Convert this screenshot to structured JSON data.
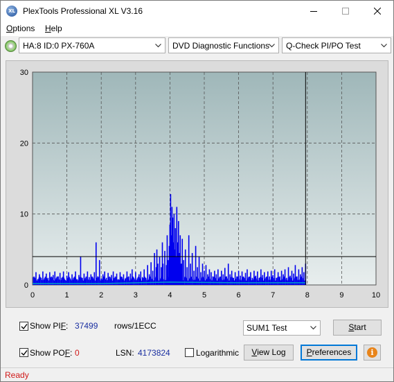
{
  "window": {
    "title": "PlexTools Professional XL V3.16",
    "icon_label": "XL"
  },
  "menu": [
    {
      "label": "Options",
      "accel": "O",
      "rest": "ptions"
    },
    {
      "label": "Help",
      "accel": "H",
      "rest": "elp"
    }
  ],
  "toolbar": {
    "drive": "HA:8 ID:0  PX-760A",
    "function": "DVD Diagnostic Functions",
    "test": "Q-Check PI/PO Test"
  },
  "chart_data": {
    "type": "bar",
    "x_ticks": [
      "0",
      "1",
      "2",
      "3",
      "4",
      "5",
      "6",
      "7",
      "8",
      "9",
      "10"
    ],
    "y_ticks": [
      "0",
      "10",
      "20",
      "30"
    ],
    "xlim": [
      0,
      10
    ],
    "ylim": [
      0,
      30
    ],
    "grid": true,
    "threshold_line": 4,
    "data_end_x": 7.95,
    "series": [
      {
        "color": "#0000ee",
        "kind": "PIF-spikes",
        "points": [
          [
            0.05,
            1
          ],
          [
            0.1,
            1.8
          ],
          [
            0.15,
            0.8
          ],
          [
            0.2,
            1.5
          ],
          [
            0.25,
            1
          ],
          [
            0.3,
            1.9
          ],
          [
            0.35,
            0.7
          ],
          [
            0.4,
            1.6
          ],
          [
            0.45,
            1
          ],
          [
            0.5,
            1.8
          ],
          [
            0.55,
            0.9
          ],
          [
            0.6,
            1.4
          ],
          [
            0.65,
            1.9
          ],
          [
            0.7,
            0.8
          ],
          [
            0.75,
            1.2
          ],
          [
            0.8,
            1.7
          ],
          [
            0.85,
            1
          ],
          [
            0.9,
            1.9
          ],
          [
            0.95,
            0.7
          ],
          [
            1.0,
            1.3
          ],
          [
            1.05,
            1.8
          ],
          [
            1.1,
            0.9
          ],
          [
            1.15,
            1.5
          ],
          [
            1.2,
            1
          ],
          [
            1.25,
            1.9
          ],
          [
            1.3,
            0.8
          ],
          [
            1.35,
            1.4
          ],
          [
            1.4,
            4
          ],
          [
            1.45,
            1
          ],
          [
            1.5,
            1.6
          ],
          [
            1.55,
            0.8
          ],
          [
            1.6,
            1.9
          ],
          [
            1.65,
            1.1
          ],
          [
            1.7,
            1.5
          ],
          [
            1.75,
            0.9
          ],
          [
            1.8,
            1.8
          ],
          [
            1.85,
            6
          ],
          [
            1.9,
            1.2
          ],
          [
            1.95,
            3.5
          ],
          [
            2.0,
            0.9
          ],
          [
            2.05,
            1.5
          ],
          [
            2.1,
            1.9
          ],
          [
            2.15,
            1
          ],
          [
            2.2,
            1.7
          ],
          [
            2.25,
            0.8
          ],
          [
            2.3,
            1.4
          ],
          [
            2.35,
            1.9
          ],
          [
            2.4,
            1
          ],
          [
            2.45,
            1.6
          ],
          [
            2.5,
            0.8
          ],
          [
            2.55,
            1.8
          ],
          [
            2.6,
            1.1
          ],
          [
            2.65,
            1.5
          ],
          [
            2.7,
            0.9
          ],
          [
            2.75,
            1.9
          ],
          [
            2.8,
            1.2
          ],
          [
            2.85,
            1.6
          ],
          [
            2.9,
            2.2
          ],
          [
            2.95,
            1
          ],
          [
            3.0,
            1.8
          ],
          [
            3.05,
            0.9
          ],
          [
            3.1,
            1.5
          ],
          [
            3.15,
            1.9
          ],
          [
            3.2,
            1.1
          ],
          [
            3.25,
            2.2
          ],
          [
            3.3,
            1
          ],
          [
            3.35,
            2.8
          ],
          [
            3.4,
            1.5
          ],
          [
            3.45,
            3.2
          ],
          [
            3.5,
            2
          ],
          [
            3.55,
            4.5
          ],
          [
            3.6,
            2.5
          ],
          [
            3.62,
            5
          ],
          [
            3.65,
            3
          ],
          [
            3.7,
            4
          ],
          [
            3.75,
            2.5
          ],
          [
            3.78,
            6
          ],
          [
            3.8,
            3
          ],
          [
            3.85,
            4.8
          ],
          [
            3.9,
            2.8
          ],
          [
            3.92,
            7
          ],
          [
            3.95,
            3.5
          ],
          [
            3.98,
            5.5
          ],
          [
            4.0,
            8.5
          ],
          [
            4.02,
            12.8
          ],
          [
            4.04,
            7
          ],
          [
            4.06,
            11
          ],
          [
            4.08,
            9.5
          ],
          [
            4.1,
            6
          ],
          [
            4.12,
            10
          ],
          [
            4.14,
            5
          ],
          [
            4.16,
            8
          ],
          [
            4.18,
            4
          ],
          [
            4.2,
            11
          ],
          [
            4.22,
            6
          ],
          [
            4.25,
            9
          ],
          [
            4.28,
            4.5
          ],
          [
            4.3,
            7
          ],
          [
            4.33,
            3
          ],
          [
            4.36,
            6.5
          ],
          [
            4.4,
            3.5
          ],
          [
            4.45,
            5
          ],
          [
            4.5,
            2.5
          ],
          [
            4.55,
            7
          ],
          [
            4.6,
            3
          ],
          [
            4.65,
            4.5
          ],
          [
            4.7,
            2
          ],
          [
            4.75,
            5.5
          ],
          [
            4.8,
            2.5
          ],
          [
            4.85,
            4
          ],
          [
            4.9,
            1.8
          ],
          [
            4.95,
            3
          ],
          [
            5.0,
            2
          ],
          [
            5.05,
            2.8
          ],
          [
            5.1,
            1.5
          ],
          [
            5.15,
            2.2
          ],
          [
            5.2,
            1.8
          ],
          [
            5.25,
            1.2
          ],
          [
            5.3,
            2
          ],
          [
            5.35,
            1.5
          ],
          [
            5.4,
            2.2
          ],
          [
            5.45,
            1
          ],
          [
            5.5,
            2
          ],
          [
            5.55,
            1.5
          ],
          [
            5.6,
            2.4
          ],
          [
            5.65,
            1.2
          ],
          [
            5.7,
            3
          ],
          [
            5.75,
            1.5
          ],
          [
            5.8,
            2
          ],
          [
            5.85,
            1
          ],
          [
            5.9,
            1.8
          ],
          [
            5.95,
            1.2
          ],
          [
            6.0,
            2
          ],
          [
            6.05,
            1.3
          ],
          [
            6.1,
            1.9
          ],
          [
            6.15,
            1
          ],
          [
            6.2,
            1.7
          ],
          [
            6.25,
            2.2
          ],
          [
            6.3,
            1.1
          ],
          [
            6.35,
            1.8
          ],
          [
            6.4,
            1
          ],
          [
            6.45,
            2
          ],
          [
            6.5,
            1.3
          ],
          [
            6.55,
            1.9
          ],
          [
            6.6,
            1
          ],
          [
            6.65,
            2.2
          ],
          [
            6.7,
            1.4
          ],
          [
            6.75,
            1.8
          ],
          [
            6.8,
            1
          ],
          [
            6.85,
            1.9
          ],
          [
            6.9,
            1.2
          ],
          [
            6.95,
            2
          ],
          [
            7.0,
            1.4
          ],
          [
            7.05,
            2.2
          ],
          [
            7.1,
            1
          ],
          [
            7.15,
            1.8
          ],
          [
            7.2,
            1.2
          ],
          [
            7.25,
            2
          ],
          [
            7.3,
            1.5
          ],
          [
            7.35,
            2.2
          ],
          [
            7.4,
            1
          ],
          [
            7.45,
            2.5
          ],
          [
            7.5,
            1.3
          ],
          [
            7.55,
            2
          ],
          [
            7.6,
            1.6
          ],
          [
            7.65,
            2.8
          ],
          [
            7.7,
            1.2
          ],
          [
            7.75,
            2.2
          ],
          [
            7.8,
            1.5
          ],
          [
            7.85,
            2.5
          ],
          [
            7.9,
            1.8
          ],
          [
            7.95,
            3
          ]
        ]
      },
      {
        "color": "#00a0c8",
        "kind": "POF-baseline",
        "points": [
          [
            0,
            0.2
          ],
          [
            2,
            0.2
          ],
          [
            4,
            0.4
          ],
          [
            6,
            0.3
          ],
          [
            7.95,
            0.3
          ]
        ]
      }
    ]
  },
  "controls": {
    "show_pif_label": "Show PIF:",
    "show_pif_accel_before": "Show PI",
    "show_pif_accel": "F",
    "show_pif_after": ":",
    "pif_value": "37499",
    "pif_unit": "rows/1ECC",
    "show_pof_label": "Show POF:",
    "show_pof_before": "Show PO",
    "show_pof_accel": "F",
    "show_pof_after": ":",
    "pof_value": "0",
    "lsn_label": "LSN:",
    "lsn_value": "4173824",
    "logarithmic_label": "Logarithmic",
    "sum_select": "SUM1 Test",
    "start_button": "Start",
    "start_accel": "S",
    "start_rest": "tart",
    "view_log_button": "View Log",
    "view_log_accel": "V",
    "view_log_rest": "iew Log",
    "preferences_button": "Preferences",
    "preferences_accel": "P",
    "preferences_rest": "references",
    "show_pif_checked": true,
    "show_pof_checked": true,
    "logarithmic_checked": false
  },
  "status": {
    "text": "Ready"
  }
}
